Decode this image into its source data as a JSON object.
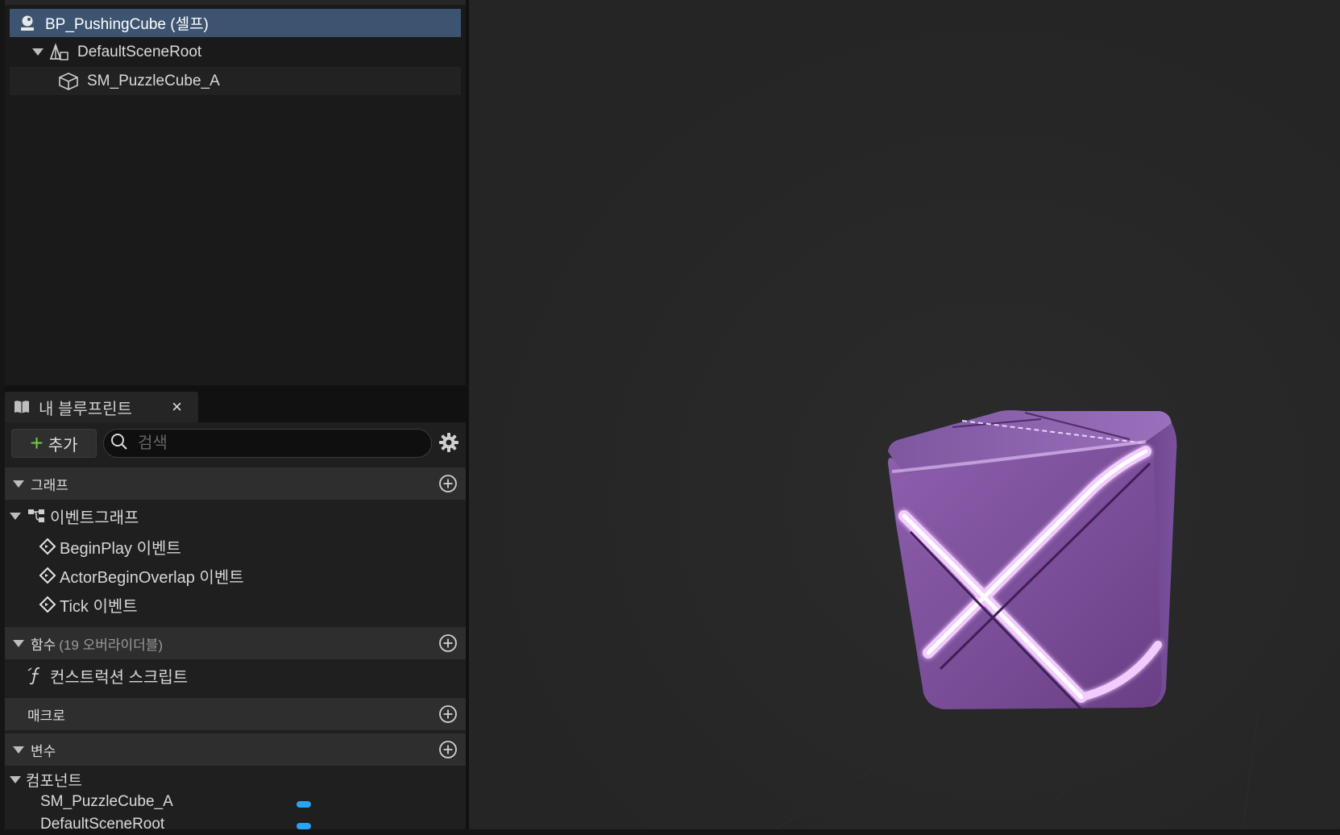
{
  "components": {
    "self_label": "BP_PushingCube (셀프)",
    "root_label": "DefaultSceneRoot",
    "mesh_label": "SM_PuzzleCube_A"
  },
  "my_blueprint": {
    "tab_label": "내 블루프린트",
    "close_glyph": "×",
    "add_label": "추가",
    "search_placeholder": "검색",
    "graphs": {
      "header": "그래프",
      "event_graph_label": "이벤트그래프",
      "events": [
        "BeginPlay 이벤트",
        "ActorBeginOverlap 이벤트",
        "Tick 이벤트"
      ]
    },
    "functions": {
      "header": "함수",
      "overridable_note": "(19 오버라이더블)",
      "items": [
        "컨스트럭션 스크립트"
      ]
    },
    "macros": {
      "header": "매크로"
    },
    "variables": {
      "header": "변수",
      "category": "컴포넌트",
      "items": [
        "SM_PuzzleCube_A",
        "DefaultSceneRoot"
      ]
    }
  },
  "colors": {
    "selection": "#3c5470",
    "accent_green": "#6fcf3b",
    "variable_pill": "#27a4f2",
    "cube_base": "#7a4b98",
    "cube_glow": "#f2ccff"
  }
}
